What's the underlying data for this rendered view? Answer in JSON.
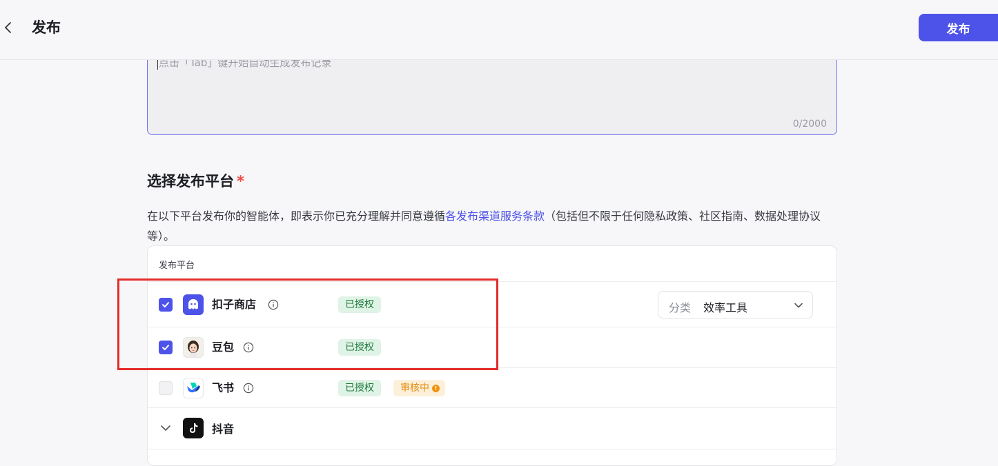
{
  "header": {
    "title": "发布",
    "publish_label": "发布"
  },
  "notes": {
    "placeholder": "点击「Tab」键开始自动生成发布记录",
    "counter": "0/2000"
  },
  "section": {
    "title": "选择发布平台",
    "required_mark": "*",
    "desc_prefix": "在以下平台发布你的智能体，即表示你已充分理解并同意遵循",
    "desc_link": "各发布渠道服务条款",
    "desc_suffix": "（包括但不限于任何隐私政策、社区指南、数据处理协议等）。"
  },
  "table": {
    "header": "发布平台",
    "rows": [
      {
        "name": "扣子商店",
        "checked": true,
        "badge": "已授权",
        "icon": "coze-store-icon",
        "category_label": "分类",
        "category_value": "效率工具"
      },
      {
        "name": "豆包",
        "checked": true,
        "badge": "已授权",
        "icon": "doubao-icon"
      },
      {
        "name": "飞书",
        "checked": false,
        "disabled": true,
        "badge": "已授权",
        "status": "审核中",
        "icon": "feishu-icon"
      },
      {
        "name": "抖音",
        "collapsed": true,
        "icon": "douyin-icon"
      }
    ]
  },
  "colors": {
    "accent": "#4d53e8",
    "highlight": "#e52a2a",
    "authorized_bg": "#dff3e6",
    "review_bg": "#fdf0da"
  }
}
